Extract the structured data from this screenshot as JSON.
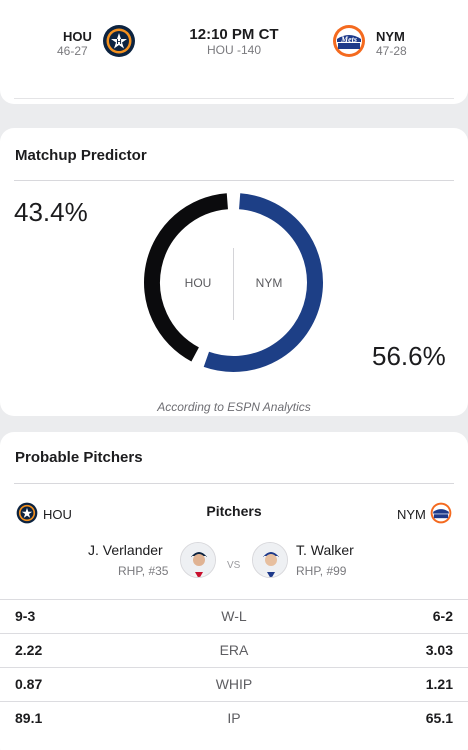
{
  "game": {
    "away": {
      "abbr": "HOU",
      "record": "46-27",
      "logo_icon": "astros-logo-icon"
    },
    "home": {
      "abbr": "NYM",
      "record": "47-28",
      "logo_icon": "mets-logo-icon"
    },
    "time": "12:10 PM CT",
    "line": "HOU -140"
  },
  "matchup": {
    "title": "Matchup Predictor",
    "away_pct": "43.4%",
    "home_pct": "56.6%",
    "away_label": "HOU",
    "home_label": "NYM",
    "credit": "According to ESPN Analytics",
    "away_share": 0.434,
    "home_share": 0.566,
    "away_color": "#0b0b0d",
    "home_color": "#1d3f86"
  },
  "pitchers": {
    "title": "Probable Pitchers",
    "away_team": "HOU",
    "home_team": "NYM",
    "center_label": "Pitchers",
    "vs": "VS",
    "away": {
      "name": "J. Verlander",
      "detail": "RHP, #35"
    },
    "home": {
      "name": "T. Walker",
      "detail": "RHP, #99"
    },
    "stats": [
      {
        "label": "W-L",
        "away": "9-3",
        "home": "6-2"
      },
      {
        "label": "ERA",
        "away": "2.22",
        "home": "3.03"
      },
      {
        "label": "WHIP",
        "away": "0.87",
        "home": "1.21"
      },
      {
        "label": "IP",
        "away": "89.1",
        "home": "65.1"
      }
    ]
  }
}
